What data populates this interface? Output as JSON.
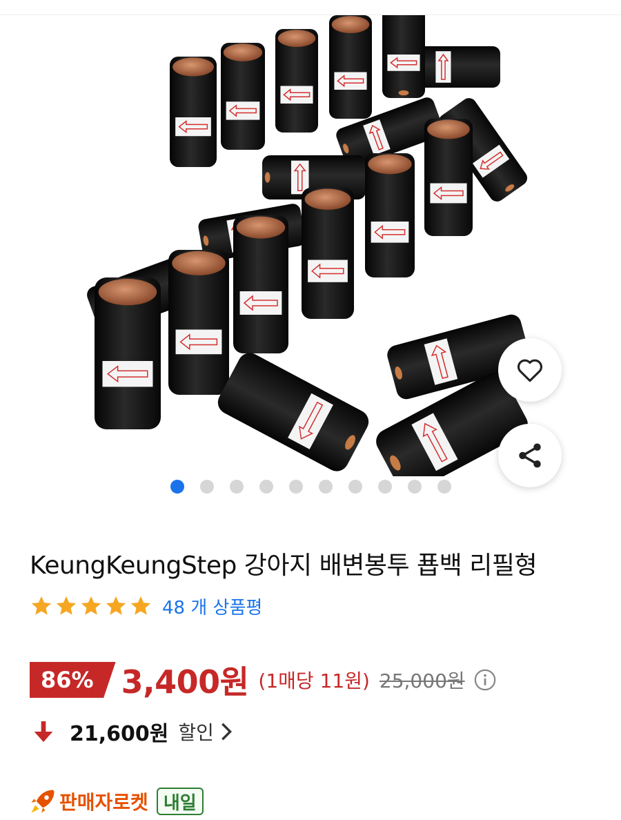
{
  "product": {
    "title": "KeungKeungStep 강아지 배변봉투 푭백 리필형",
    "gallery": {
      "image_desc_icon": "product-photo",
      "image_count": 10,
      "active_index": 0
    },
    "rating": {
      "stars": 5,
      "max_stars": 5,
      "review_count_text": "48 개 상품평"
    },
    "price": {
      "discount_badge": "86%",
      "sale_price": "3,400원",
      "unit_price": "(1매당 11원)",
      "original_price": "25,000원",
      "info_icon": "info-icon"
    },
    "coupon": {
      "amount": "21,600원",
      "label": "할인",
      "icon": "down-arrow-icon"
    },
    "delivery": {
      "name": "판매자로켓",
      "badge": "내일",
      "icon": "rocket-icon"
    },
    "actions": {
      "like_icon": "heart-icon",
      "share_icon": "share-icon"
    }
  },
  "colors": {
    "accent_blue": "#1a73e8",
    "price_red": "#c62828",
    "star_orange": "#f5a623",
    "delivery_orange": "#e65100",
    "delivery_green": "#2e7d32"
  }
}
